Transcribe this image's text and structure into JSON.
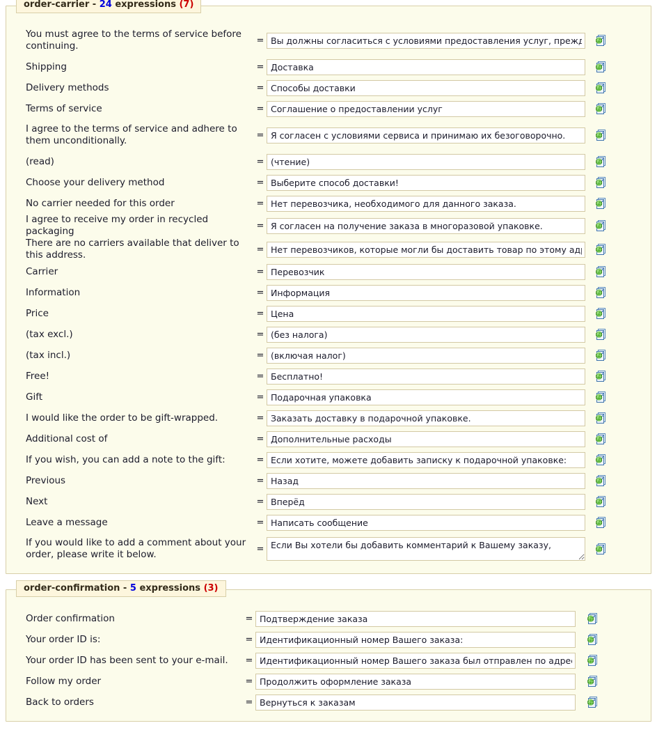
{
  "panels": [
    {
      "name": "order-carrier",
      "separator": "-",
      "count": "24",
      "count_word": "expressions",
      "missing": "(7)",
      "icon_name": "translate-globe-icon",
      "rows": [
        {
          "label": "You must agree to the terms of service before continuing.",
          "eq": "=",
          "value": "Вы должны согласиться с условиями предоставления услуг, прежде чем",
          "type": "input",
          "tall": true
        },
        {
          "label": "Shipping",
          "eq": "=",
          "value": "Доставка",
          "type": "input",
          "tall": false
        },
        {
          "label": "Delivery methods",
          "eq": "=",
          "value": "Способы доставки",
          "type": "input",
          "tall": false
        },
        {
          "label": "Terms of service",
          "eq": "=",
          "value": "Соглашение о предоставлении услуг",
          "type": "input",
          "tall": false
        },
        {
          "label": "I agree to the terms of service and adhere to them unconditionally.",
          "eq": "=",
          "value": "Я согласен с условиями сервиса и принимаю их безоговорочно.",
          "type": "input",
          "tall": true
        },
        {
          "label": "(read)",
          "eq": "=",
          "value": "(чтение)",
          "type": "input",
          "tall": false
        },
        {
          "label": "Choose your delivery method",
          "eq": "=",
          "value": "Выберите способ доставки!",
          "type": "input",
          "tall": false
        },
        {
          "label": "No carrier needed for this order",
          "eq": "=",
          "value": "Нет перевозчика, необходимого для данного заказа.",
          "type": "input",
          "tall": false
        },
        {
          "label": "I agree to receive my order in recycled packaging",
          "eq": "=",
          "value": "Я согласен на получение заказа в многоразовой упаковке.",
          "type": "input",
          "tall": false
        },
        {
          "label": "There are no carriers available that deliver to this address.",
          "eq": "=",
          "value": "Нет перевозчиков, которые могли бы доставить товар по этому адресу.",
          "type": "input",
          "tall": false
        },
        {
          "label": "Carrier",
          "eq": "=",
          "value": "Перевозчик",
          "type": "input",
          "tall": false
        },
        {
          "label": "Information",
          "eq": "=",
          "value": "Информация",
          "type": "input",
          "tall": false
        },
        {
          "label": "Price",
          "eq": "=",
          "value": "Цена",
          "type": "input",
          "tall": false
        },
        {
          "label": "(tax excl.)",
          "eq": "=",
          "value": "(без налога)",
          "type": "input",
          "tall": false
        },
        {
          "label": "(tax incl.)",
          "eq": "=",
          "value": "(включая налог)",
          "type": "input",
          "tall": false
        },
        {
          "label": "Free!",
          "eq": "=",
          "value": "Бесплатно!",
          "type": "input",
          "tall": false
        },
        {
          "label": "Gift",
          "eq": "=",
          "value": "Подарочная упаковка",
          "type": "input",
          "tall": false
        },
        {
          "label": "I would like the order to be gift-wrapped.",
          "eq": "=",
          "value": "Заказать доставку в подарочной упаковке.",
          "type": "input",
          "tall": false
        },
        {
          "label": "Additional cost of",
          "eq": "=",
          "value": "Дополнительные расходы",
          "type": "input",
          "tall": false
        },
        {
          "label": "If you wish, you can add a note to the gift:",
          "eq": "=",
          "value": "Если хотите, можете добавить записку к подарочной упаковке:",
          "type": "input",
          "tall": false
        },
        {
          "label": "Previous",
          "eq": "=",
          "value": "Назад",
          "type": "input",
          "tall": false
        },
        {
          "label": "Next",
          "eq": "=",
          "value": "Вперёд",
          "type": "input",
          "tall": false
        },
        {
          "label": "Leave a message",
          "eq": "=",
          "value": "Написать сообщение",
          "type": "input",
          "tall": false
        },
        {
          "label": "If you would like to add a comment about your order, please write it below.",
          "eq": "=",
          "value": "Если Вы хотели бы добавить комментарий к Вашему заказу,",
          "type": "textarea",
          "tall": true
        }
      ]
    },
    {
      "name": "order-confirmation",
      "separator": "-",
      "count": "5",
      "count_word": "expressions",
      "missing": "(3)",
      "icon_name": "translate-globe-icon",
      "rows": [
        {
          "label": "Order confirmation",
          "eq": "=",
          "value": "Подтверждение заказа",
          "type": "input",
          "tall": false
        },
        {
          "label": "Your order ID is:",
          "eq": "=",
          "value": "Идентификационный номер Вашего заказа:",
          "type": "input",
          "tall": false
        },
        {
          "label": "Your order ID has been sent to your e-mail.",
          "eq": "=",
          "value": "Идентификационный номер Вашего заказа был отправлен по адресу Ва",
          "type": "input",
          "tall": false
        },
        {
          "label": "Follow my order",
          "eq": "=",
          "value": "Продолжить оформление заказа",
          "type": "input",
          "tall": false
        },
        {
          "label": "Back to orders",
          "eq": "=",
          "value": "Вернуться к заказам",
          "type": "input",
          "tall": false
        }
      ]
    }
  ]
}
